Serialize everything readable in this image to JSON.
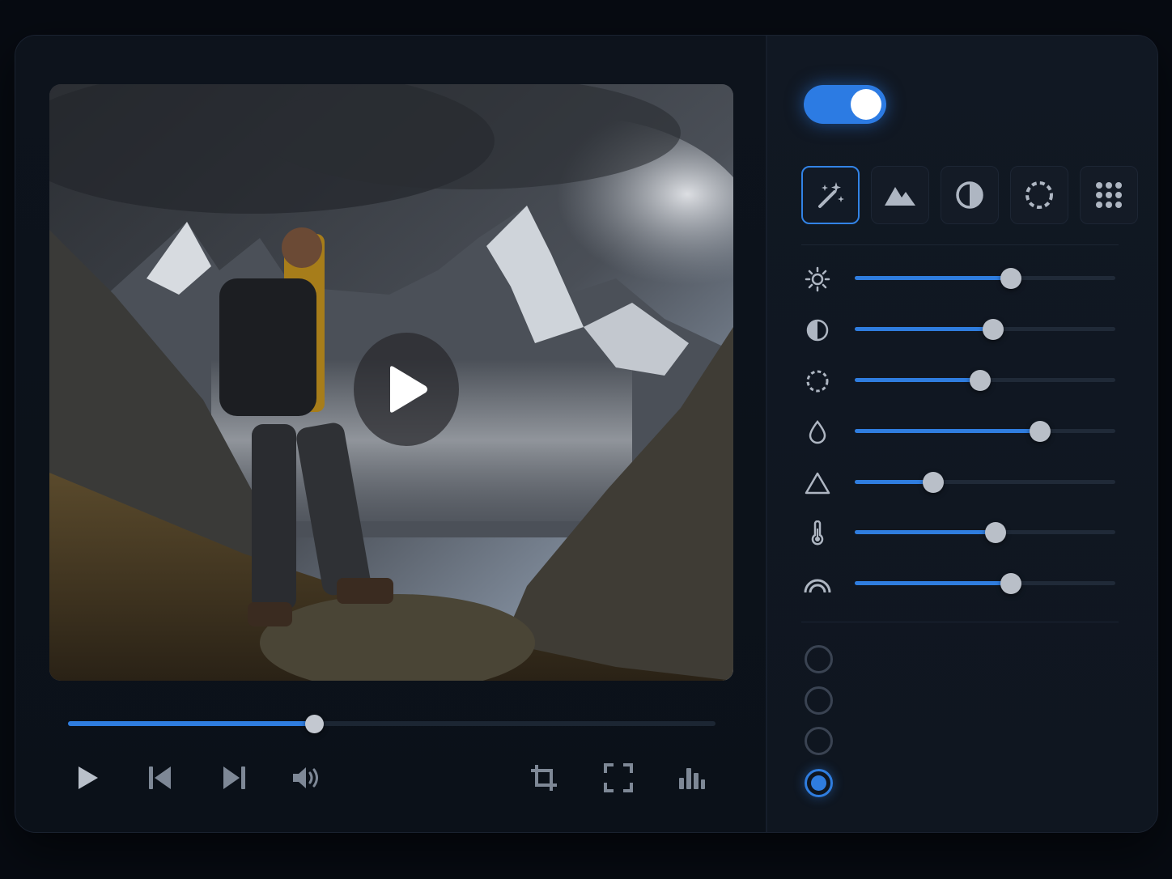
{
  "player": {
    "progress": 0.38,
    "controls": [
      "play-icon",
      "skip-back-icon",
      "skip-forward-icon",
      "volume-icon",
      "crop-icon",
      "fullscreen-icon",
      "bar-chart-icon"
    ],
    "accent": "#2f7ddf"
  },
  "panel": {
    "toggle_on": true,
    "tools": [
      "magic-wand-icon",
      "mountain-icon",
      "contrast-icon",
      "dotted-circle-icon",
      "grid-icon"
    ],
    "active_tool": 0,
    "adjustments": [
      {
        "icon": "sun-icon",
        "value": 0.6
      },
      {
        "icon": "half-circle-icon",
        "value": 0.53
      },
      {
        "icon": "dotted-circle-icon",
        "value": 0.48
      },
      {
        "icon": "droplet-icon",
        "value": 0.71
      },
      {
        "icon": "triangle-icon",
        "value": 0.3
      },
      {
        "icon": "thermometer-icon",
        "value": 0.54
      },
      {
        "icon": "rainbow-icon",
        "value": 0.6
      }
    ],
    "radio_options": 4,
    "selected_radio": 3
  }
}
